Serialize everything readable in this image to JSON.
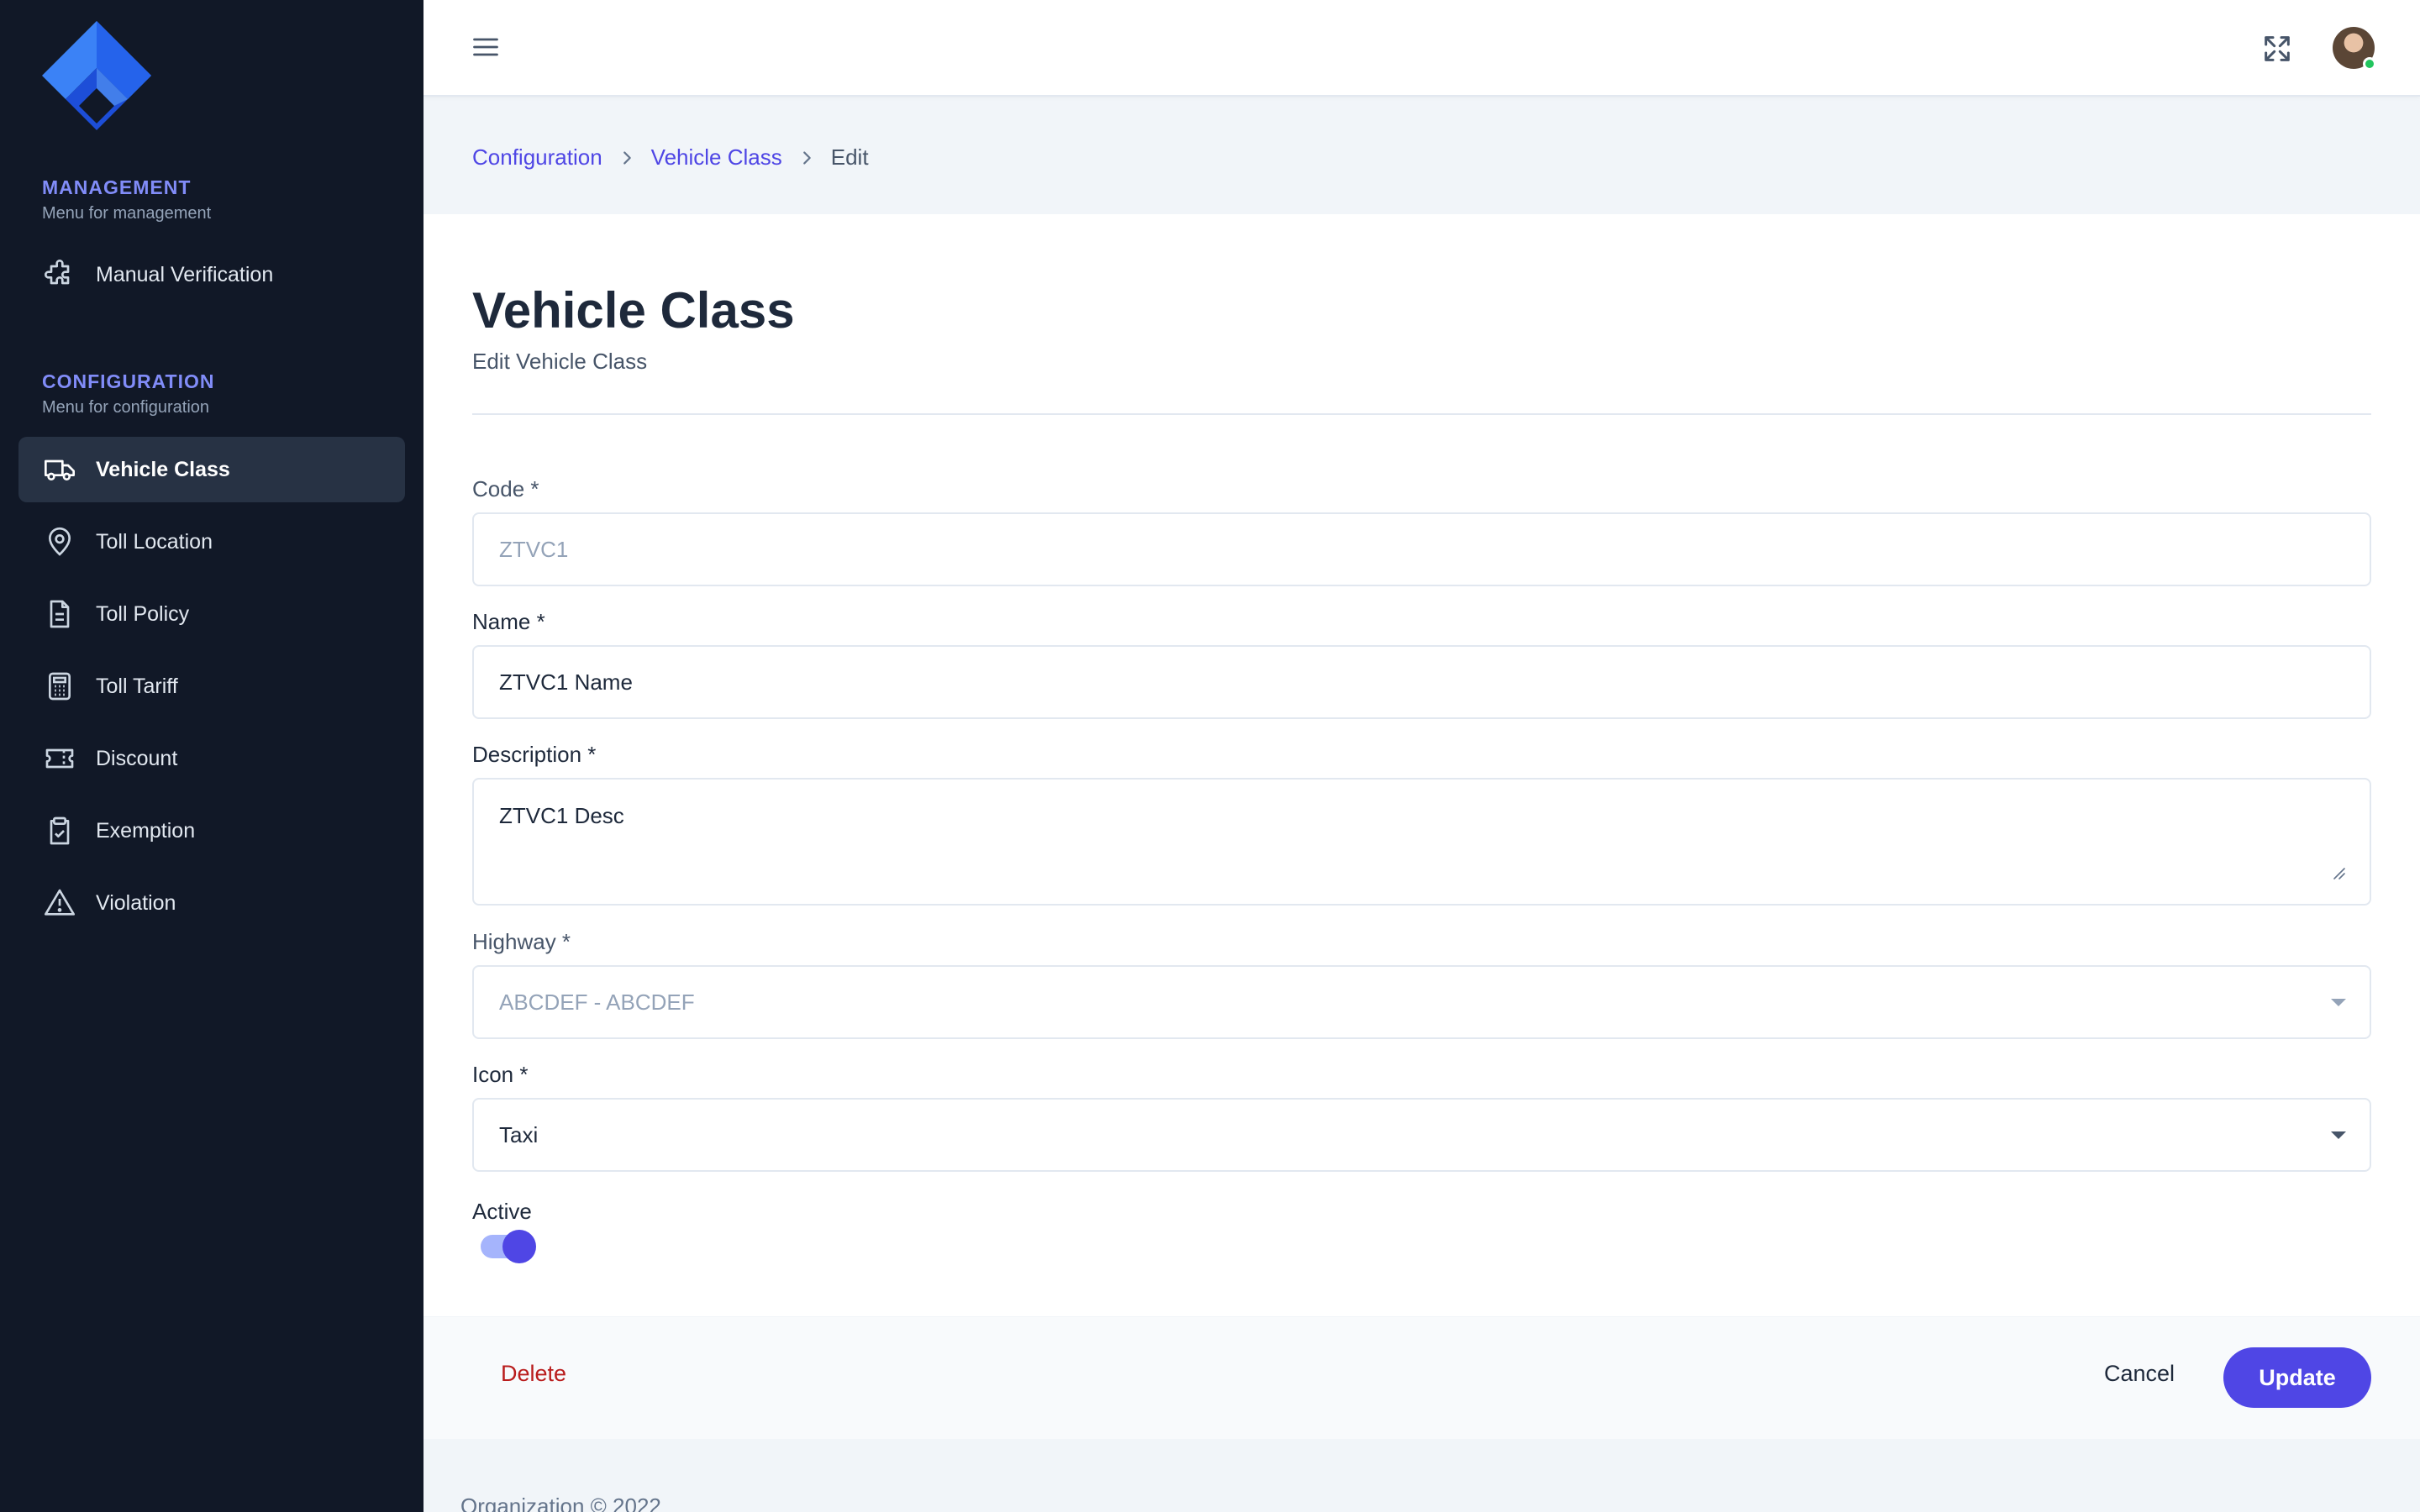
{
  "sidebar": {
    "management": {
      "title": "MANAGEMENT",
      "subtitle": "Menu for management",
      "items": [
        {
          "label": "Manual Verification",
          "icon": "puzzle-icon"
        }
      ]
    },
    "configuration": {
      "title": "CONFIGURATION",
      "subtitle": "Menu for configuration",
      "items": [
        {
          "label": "Vehicle Class",
          "icon": "truck-icon",
          "active": true
        },
        {
          "label": "Toll Location",
          "icon": "map-pin-icon"
        },
        {
          "label": "Toll Policy",
          "icon": "document-icon"
        },
        {
          "label": "Toll Tariff",
          "icon": "calculator-icon"
        },
        {
          "label": "Discount",
          "icon": "ticket-icon"
        },
        {
          "label": "Exemption",
          "icon": "clipboard-check-icon"
        },
        {
          "label": "Violation",
          "icon": "warning-icon"
        }
      ]
    }
  },
  "breadcrumb": {
    "items": [
      "Configuration",
      "Vehicle Class"
    ],
    "current": "Edit"
  },
  "page": {
    "title": "Vehicle Class",
    "subtitle": "Edit Vehicle Class"
  },
  "form": {
    "code": {
      "label": "Code *",
      "value": "ZTVC1"
    },
    "name": {
      "label": "Name *",
      "value": "ZTVC1 Name"
    },
    "description": {
      "label": "Description *",
      "value": "ZTVC1 Desc"
    },
    "highway": {
      "label": "Highway *",
      "value": "ABCDEF - ABCDEF"
    },
    "icon": {
      "label": "Icon *",
      "value": "Taxi"
    },
    "active": {
      "label": "Active",
      "value": true
    }
  },
  "actions": {
    "delete": "Delete",
    "cancel": "Cancel",
    "update": "Update"
  },
  "footer": {
    "text": "Organization © 2022"
  },
  "colors": {
    "sidebar_bg": "#111827",
    "accent": "#4f46e5",
    "danger": "#b91c1c",
    "status_online": "#22c55e"
  }
}
